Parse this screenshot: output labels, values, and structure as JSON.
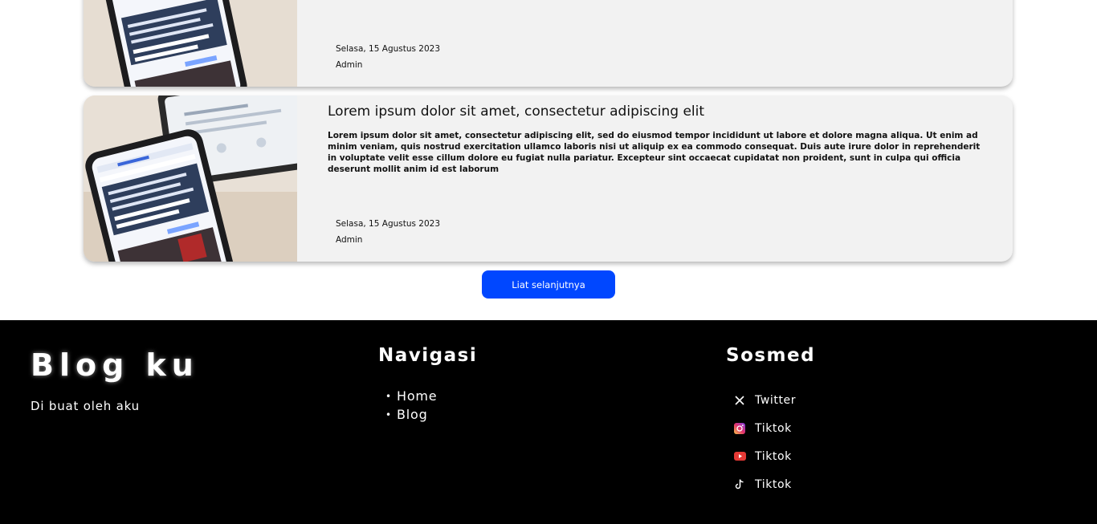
{
  "posts": [
    {
      "title": "",
      "excerpt": "",
      "date": "Selasa, 15 Agustus 2023",
      "author": "Admin"
    },
    {
      "title": "Lorem ipsum dolor sit amet, consectetur adipiscing elit",
      "excerpt": "Lorem ipsum dolor sit amet, consectetur adipiscing elit, sed do eiusmod tempor incididunt ut labore et dolore magna aliqua. Ut enim ad minim veniam, quis nostrud exercitation ullamco laboris nisi ut aliquip ex ea commodo consequat. Duis aute irure dolor in reprehenderit in voluptate velit esse cillum dolore eu fugiat nulla pariatur. Excepteur sint occaecat cupidatat non proident, sunt in culpa qui officia deserunt mollit anim id est laborum",
      "date": "Selasa, 15 Agustus 2023",
      "author": "Admin"
    }
  ],
  "more_button": "Liat selanjutnya",
  "footer": {
    "brand": "Blog ku",
    "brand_sub": "Di buat oleh aku",
    "nav_title": "Navigasi",
    "nav_items": [
      "Home",
      "Blog"
    ],
    "sosmed_title": "Sosmed",
    "sosmed_items": [
      {
        "label": "Twitter",
        "icon": "x-icon"
      },
      {
        "label": "Tiktok",
        "icon": "instagram-icon"
      },
      {
        "label": "Tiktok",
        "icon": "youtube-icon"
      },
      {
        "label": "Tiktok",
        "icon": "tiktok-icon"
      }
    ]
  },
  "colors": {
    "button_blue": "#0047ff",
    "card_bg": "#f2f2f2",
    "footer_bg": "#000000"
  }
}
